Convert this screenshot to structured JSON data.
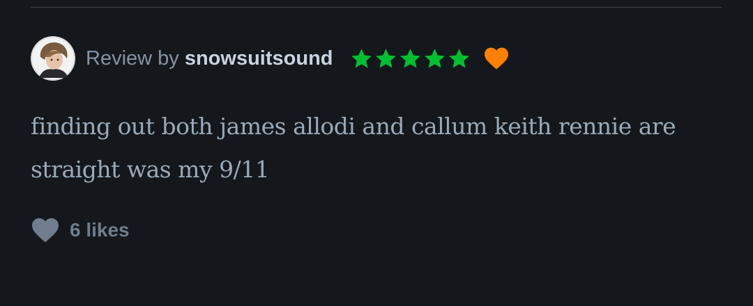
{
  "review": {
    "prefix": "Review by",
    "username": "snowsuitsound",
    "rating_stars": 5,
    "liked": true,
    "text": "finding out both james allodi and callum keith rennie are straight was my 9/11",
    "likes_count_label": "6 likes"
  },
  "icons": {
    "avatar": "user-avatar",
    "star": "star-icon",
    "liked": "heart-icon",
    "like_button": "heart-icon"
  },
  "colors": {
    "background": "#14181c",
    "star": "#00c030",
    "liked_heart": "#ff8000",
    "username": "#c7d3df",
    "muted": "#8593a3",
    "body_text": "#9aaab9",
    "likes": "#6f7d8c"
  }
}
